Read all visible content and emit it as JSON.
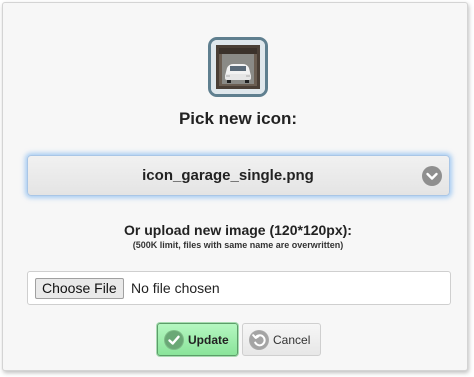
{
  "dialog": {
    "pick_title": "Pick new icon:",
    "current_icon": "garage-single-icon",
    "select": {
      "selected_value": "icon_garage_single.png"
    },
    "upload_title": "Or upload new image (120*120px):",
    "upload_note": "(500K limit, files with same name are overwritten)",
    "file_input": {
      "button_label": "Choose File",
      "status_text": "No file chosen"
    },
    "buttons": {
      "update_label": "Update",
      "cancel_label": "Cancel"
    }
  },
  "colors": {
    "focus_glow": "#66aaee",
    "update_bg": "#9eeeab",
    "icon_border": "#5f7f8f"
  }
}
